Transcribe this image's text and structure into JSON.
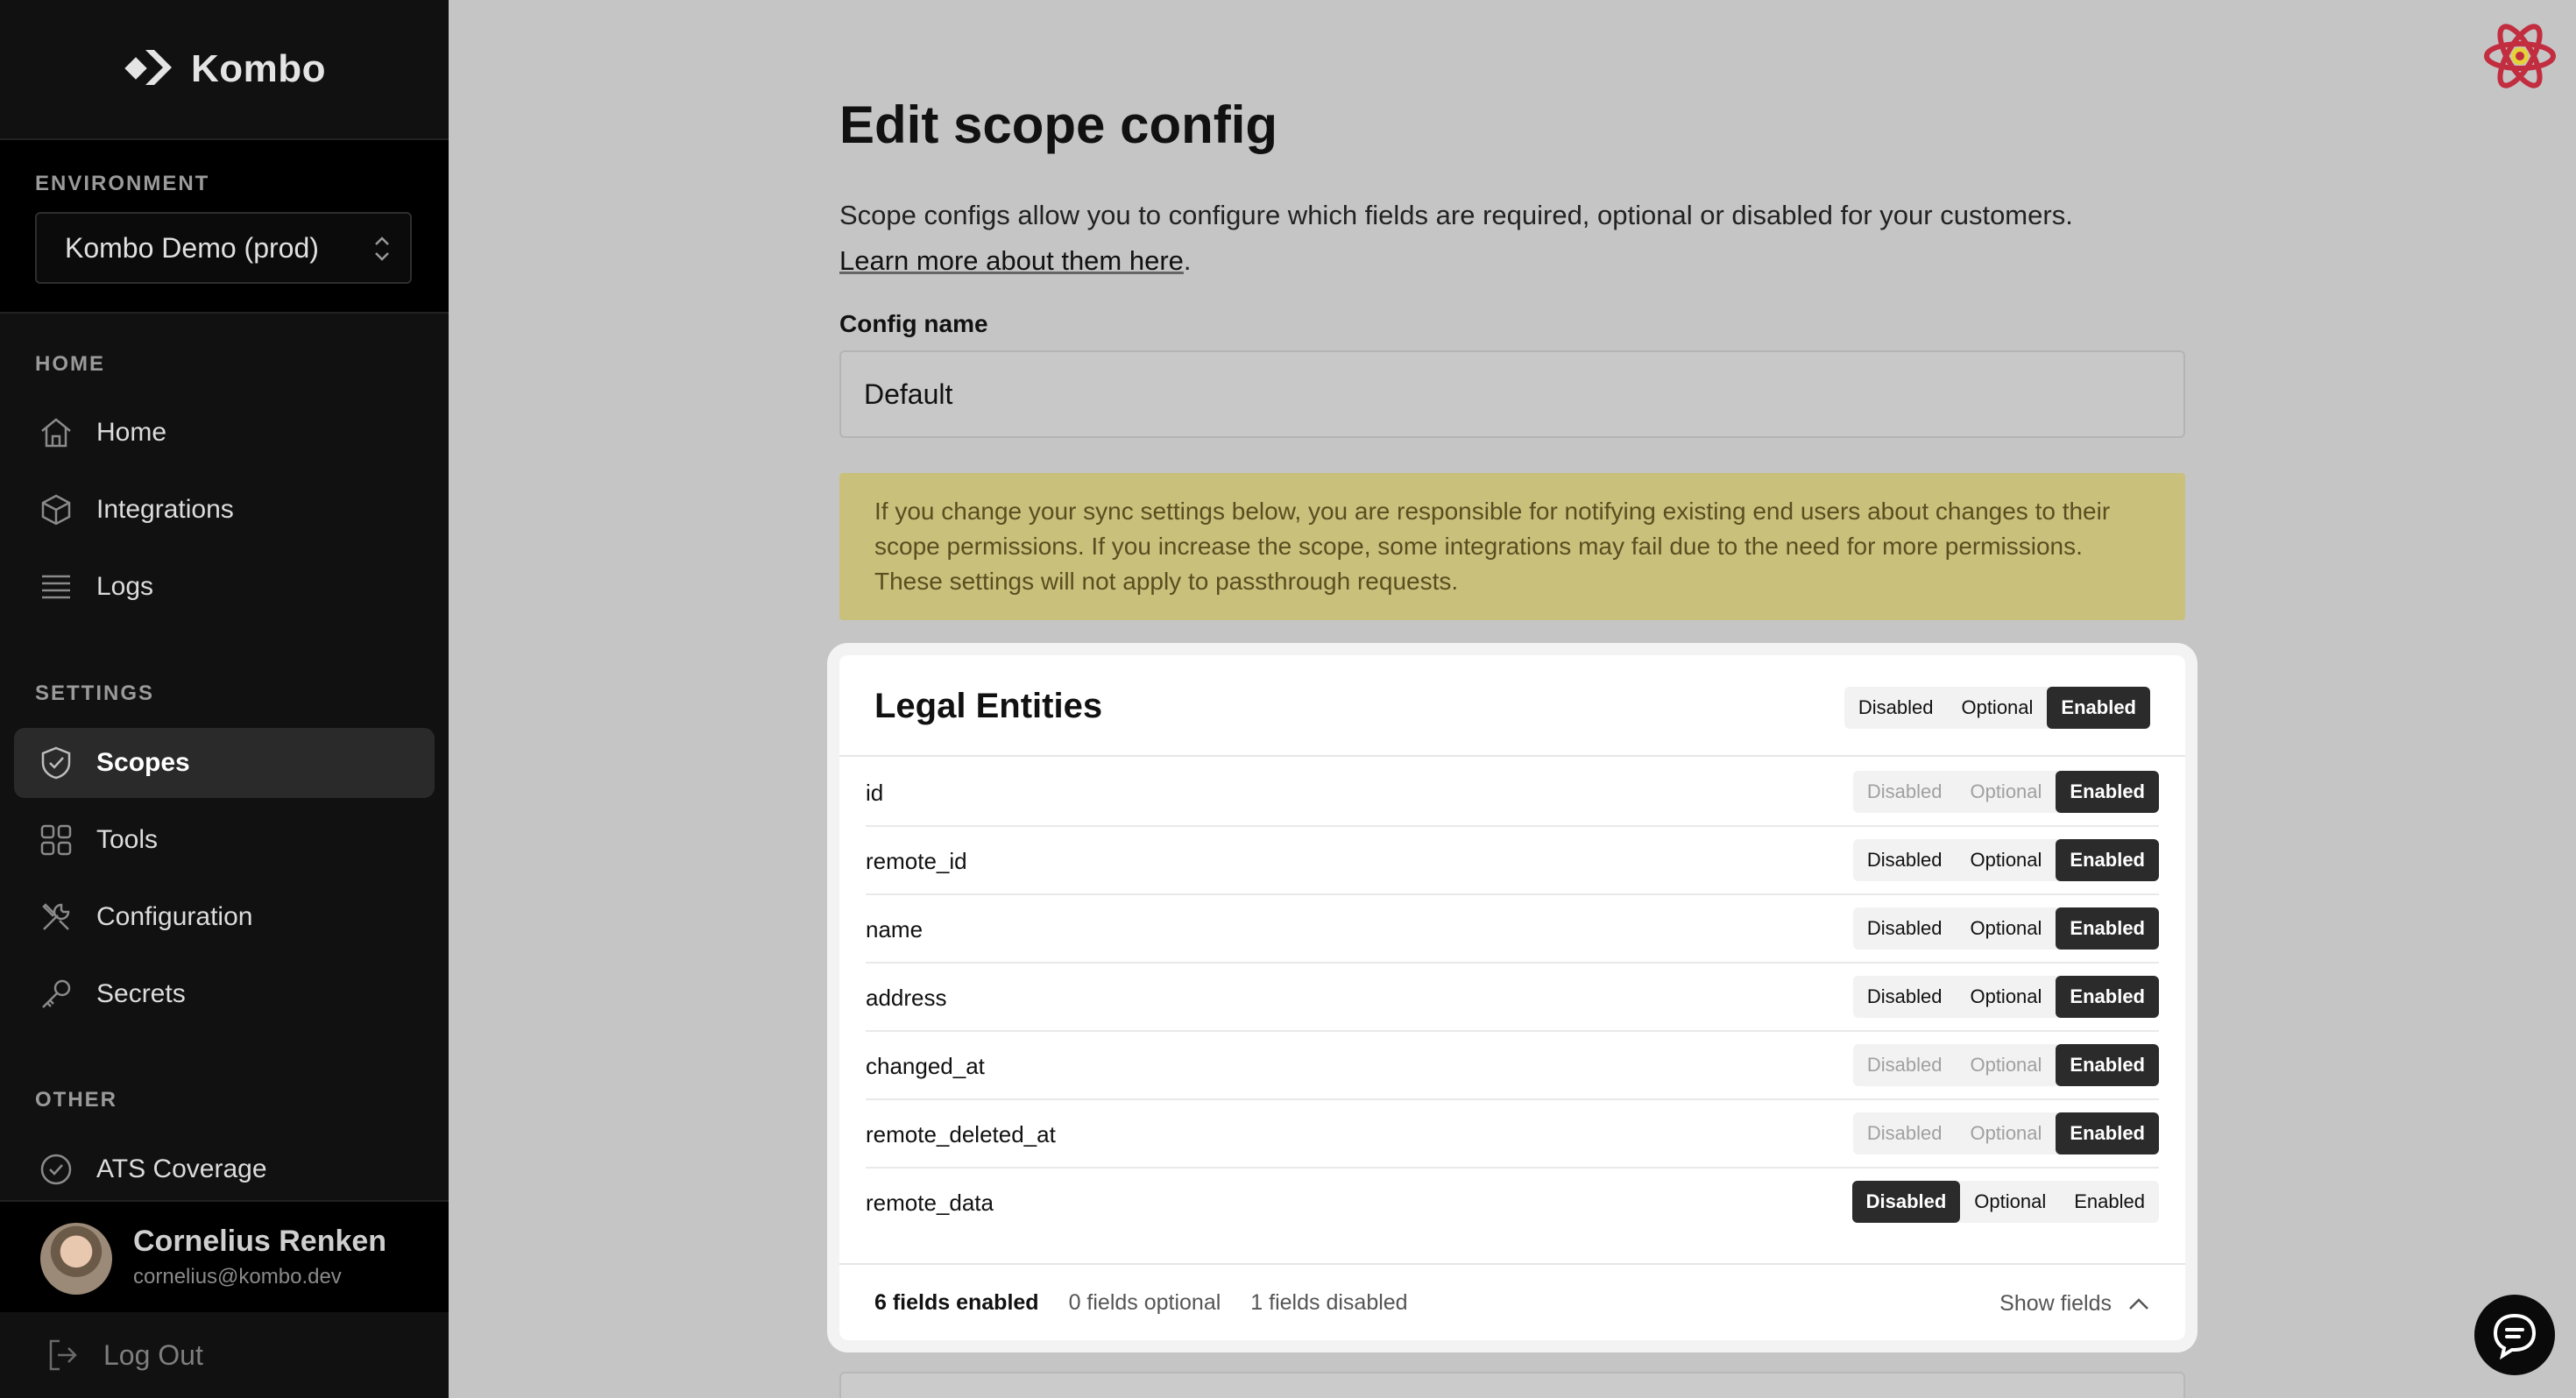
{
  "brand": {
    "name": "Kombo"
  },
  "environment": {
    "section_label": "ENVIRONMENT",
    "selected": "Kombo Demo (prod)"
  },
  "nav": {
    "home_label": "HOME",
    "settings_label": "SETTINGS",
    "other_label": "OTHER",
    "items": [
      {
        "label": "Home",
        "icon": "home-icon"
      },
      {
        "label": "Integrations",
        "icon": "cube-icon"
      },
      {
        "label": "Logs",
        "icon": "list-icon"
      },
      {
        "label": "Scopes",
        "icon": "shield-icon",
        "active": true
      },
      {
        "label": "Tools",
        "icon": "grid-icon"
      },
      {
        "label": "Configuration",
        "icon": "tools-icon"
      },
      {
        "label": "Secrets",
        "icon": "key-icon"
      },
      {
        "label": "ATS Coverage",
        "icon": "check-circle-icon"
      }
    ]
  },
  "user": {
    "name": "Cornelius Renken",
    "email": "cornelius@kombo.dev"
  },
  "logout_label": "Log Out",
  "page": {
    "title": "Edit scope config",
    "description": "Scope configs allow you to configure which fields are required, optional or disabled for your customers.",
    "learn_more": "Learn more about them here",
    "learn_more_suffix": ".",
    "config_name_label": "Config name",
    "config_name_value": "Default",
    "warning": "If you change your sync settings below, you are responsible for notifying existing end users about changes to their scope permissions. If you increase the scope, some integrations may fail due to the need for more permissions. These settings will not apply to passthrough requests."
  },
  "card": {
    "title": "Legal Entities",
    "options": [
      "Disabled",
      "Optional",
      "Enabled"
    ],
    "header_state": "Enabled",
    "fields": [
      {
        "name": "id",
        "state": "Enabled",
        "locked": true
      },
      {
        "name": "remote_id",
        "state": "Enabled",
        "locked": false
      },
      {
        "name": "name",
        "state": "Enabled",
        "locked": false
      },
      {
        "name": "address",
        "state": "Enabled",
        "locked": false
      },
      {
        "name": "changed_at",
        "state": "Enabled",
        "locked": true
      },
      {
        "name": "remote_deleted_at",
        "state": "Enabled",
        "locked": true
      },
      {
        "name": "remote_data",
        "state": "Disabled",
        "locked": false
      }
    ],
    "footer": {
      "enabled": "6 fields enabled",
      "optional": "0 fields optional",
      "disabled": "1 fields disabled",
      "toggle": "Show fields"
    }
  },
  "colors": {
    "sidebar_bg": "#111111",
    "overlay_bg": "#c5c5c5",
    "warning_bg": "#c9c07c",
    "toggle_on": "#2b2b2b"
  }
}
